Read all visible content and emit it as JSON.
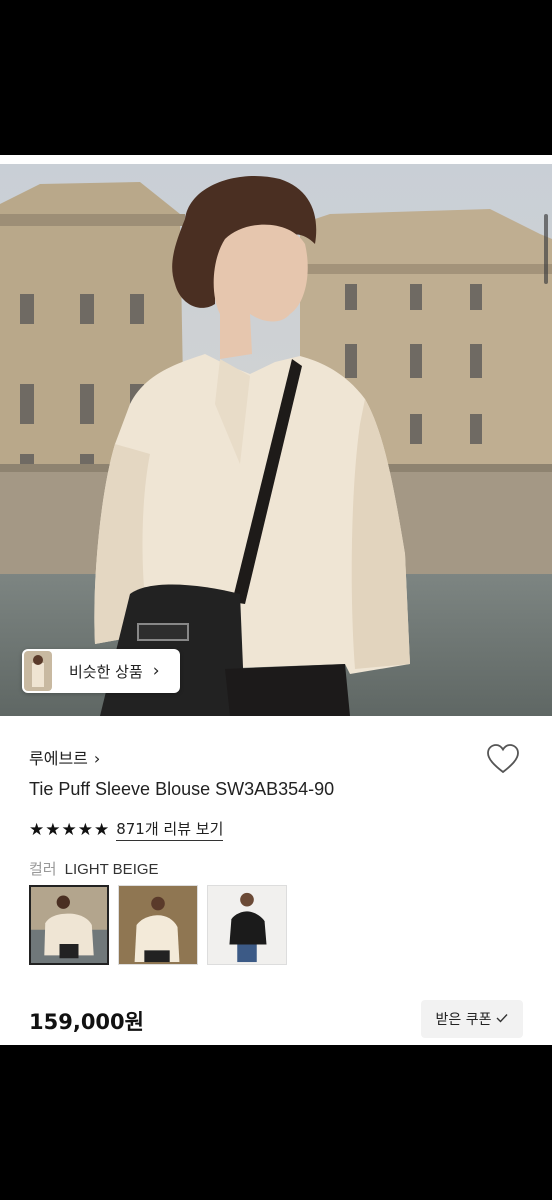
{
  "hero": {
    "image": "model-beige-blouse-photo"
  },
  "similar_button": {
    "label": "비슷한 상품",
    "chevron": "›"
  },
  "product": {
    "brand": "루에브르",
    "brand_chevron": "›",
    "title": "Tie Puff Sleeve Blouse SW3AB354-90",
    "rating_stars": "★★★★★",
    "rating_value": 5,
    "reviews_label": "871개 리뷰 보기",
    "color_key": "컬러",
    "color_value": "LIGHT BEIGE",
    "swatches": [
      {
        "name": "light-beige",
        "selected": true
      },
      {
        "name": "cream",
        "selected": false
      },
      {
        "name": "black",
        "selected": false
      }
    ],
    "price": "159,000원"
  },
  "coupon": {
    "label": "받은 쿠폰",
    "icon": "check-icon"
  },
  "colors": {
    "accent": "#111111",
    "background": "#ffffff"
  }
}
